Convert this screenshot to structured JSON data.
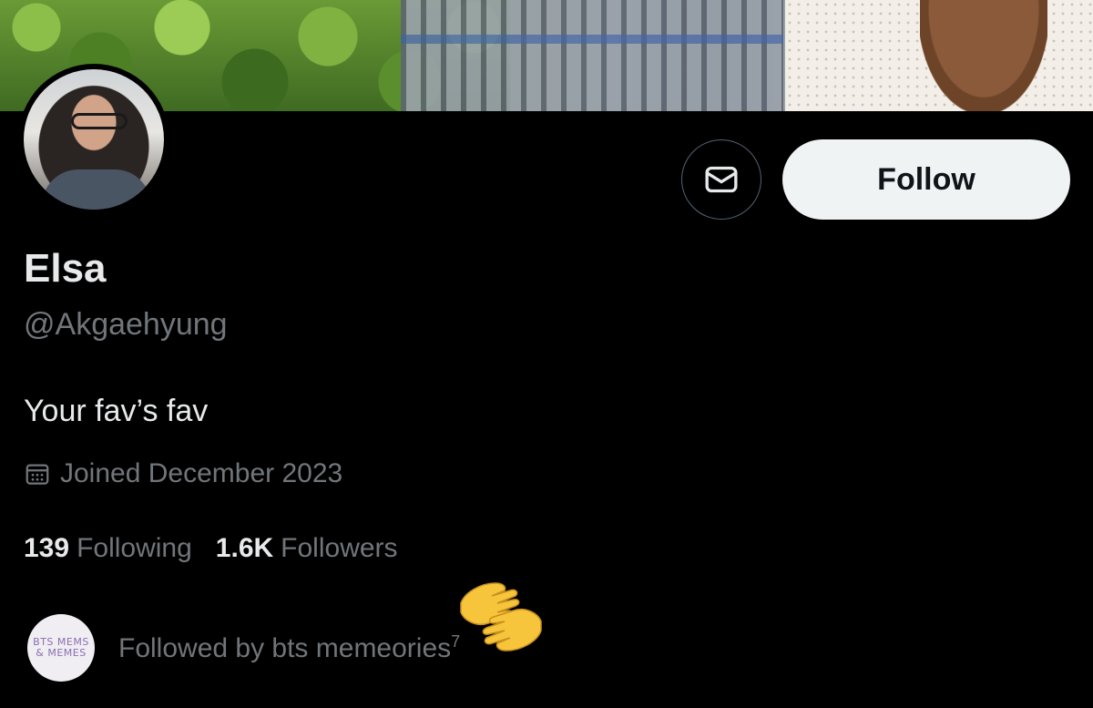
{
  "profile": {
    "name": "Elsa",
    "handle": "@Akgaehyung",
    "bio": "Your fav’s fav",
    "joined": "Joined December 2023"
  },
  "actions": {
    "follow_label": "Follow",
    "message_icon": "mail-icon"
  },
  "stats": {
    "following_count": "139",
    "following_label": "Following",
    "followers_count": "1.6K",
    "followers_label": "Followers"
  },
  "followed_by": {
    "text": "Followed by bts memeories",
    "superscript": "7",
    "avatar_lines": [
      "BTS MEMS",
      "& MEMES"
    ]
  },
  "emoji": "raised-hands"
}
